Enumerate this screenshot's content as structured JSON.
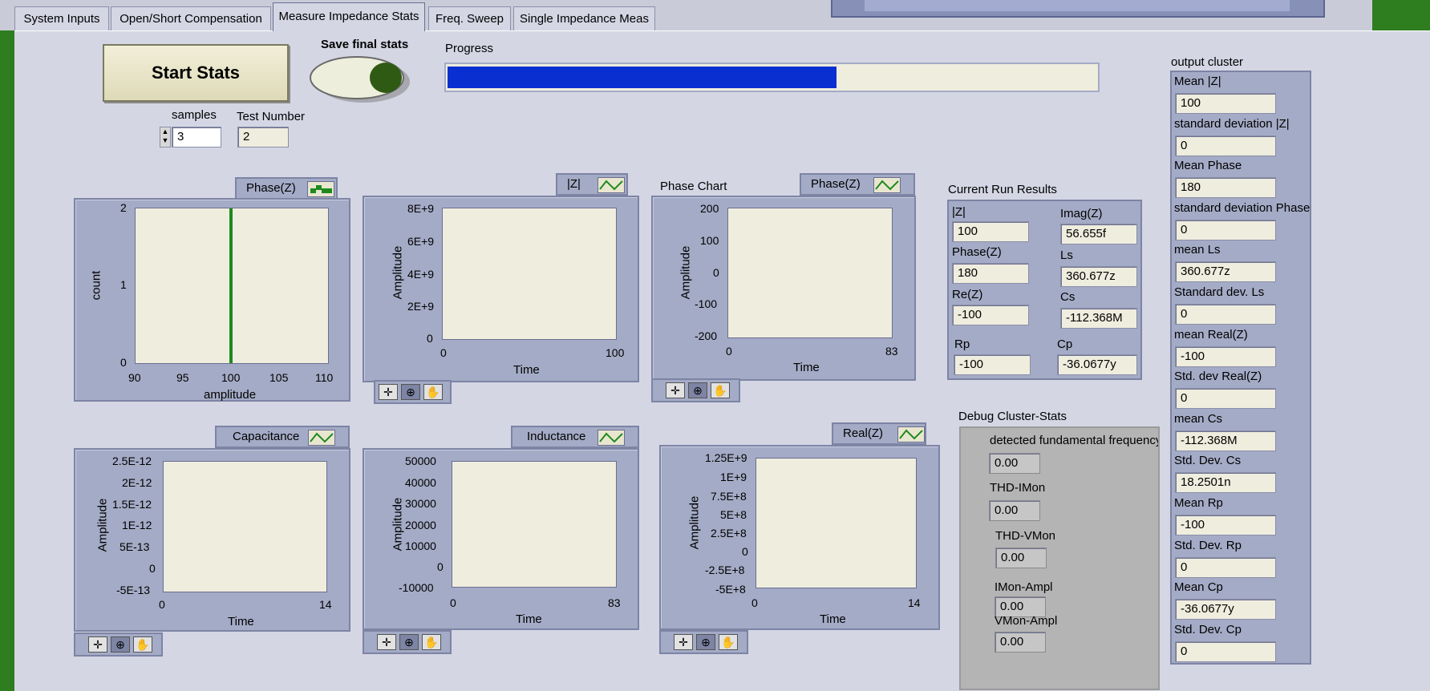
{
  "tabs": [
    "System Inputs",
    "Open/Short Compensation",
    "Measure Impedance Stats",
    "Freq. Sweep",
    "Single Impedance Meas"
  ],
  "controls": {
    "start_button": "Start Stats",
    "save_final_stats_label": "Save final stats",
    "progress_label": "Progress",
    "progress_fraction": 0.6,
    "samples_label": "samples",
    "samples_value": "3",
    "test_number_label": "Test Number",
    "test_number_value": "2"
  },
  "graphs": {
    "histogram": {
      "legend": "Phase(Z)",
      "y_ticks": [
        "2",
        "1",
        "0"
      ],
      "x_ticks": [
        "90",
        "95",
        "100",
        "105",
        "110"
      ],
      "ylabel": "count",
      "xlabel": "amplitude",
      "bar_x": 100
    },
    "z_chart": {
      "legend": "|Z|",
      "y_ticks": [
        "8E+9",
        "6E+9",
        "4E+9",
        "2E+9",
        "0"
      ],
      "x_ticks": [
        "0",
        "100"
      ],
      "ylabel": "Amplitude",
      "xlabel": "Time"
    },
    "phase_chart": {
      "title": "Phase Chart",
      "legend": "Phase(Z)",
      "y_ticks": [
        "200",
        "100",
        "0",
        "-100",
        "-200"
      ],
      "x_ticks": [
        "0",
        "83"
      ],
      "ylabel": "Amplitude",
      "xlabel": "Time"
    },
    "capacitance_chart": {
      "legend": "Capacitance",
      "y_ticks": [
        "2.5E-12",
        "2E-12",
        "1.5E-12",
        "1E-12",
        "5E-13",
        "0",
        "-5E-13"
      ],
      "x_ticks": [
        "0",
        "14"
      ],
      "ylabel": "Amplitude",
      "xlabel": "Time"
    },
    "inductance_chart": {
      "legend": "Inductance",
      "y_ticks": [
        "50000",
        "40000",
        "30000",
        "20000",
        "10000",
        "0",
        "-10000"
      ],
      "x_ticks": [
        "0",
        "83"
      ],
      "ylabel": "Amplitude",
      "xlabel": "Time"
    },
    "real_chart": {
      "legend": "Real(Z)",
      "y_ticks": [
        "1.25E+9",
        "1E+9",
        "7.5E+8",
        "5E+8",
        "2.5E+8",
        "0",
        "-2.5E+8",
        "-5E+8"
      ],
      "x_ticks": [
        "0",
        "14"
      ],
      "ylabel": "Amplitude",
      "xlabel": "Time"
    }
  },
  "current_run": {
    "title": "Current Run Results",
    "z_label": "|Z|",
    "z_value": "100",
    "imag_label": "Imag(Z)",
    "imag_value": "56.655f",
    "phase_label": "Phase(Z)",
    "phase_value": "180",
    "ls_label": "Ls",
    "ls_value": "360.677z",
    "re_label": "Re(Z)",
    "re_value": "-100",
    "cs_label": "Cs",
    "cs_value": "-112.368M",
    "rp_label": "Rp",
    "rp_value": "-100",
    "cp_label": "Cp",
    "cp_value": "-36.0677y"
  },
  "debug": {
    "title": "Debug Cluster-Stats",
    "fund_label": "detected fundamental frequency",
    "fund_value": "0.00",
    "thd_imon_label": "THD-IMon",
    "thd_imon_value": "0.00",
    "thd_vmon_label": "THD-VMon",
    "thd_vmon_value": "0.00",
    "imon_ampl_label": "IMon-Ampl",
    "imon_ampl_value": "0.00",
    "vmon_ampl_label": "VMon-Ampl",
    "vmon_ampl_value": "0.00"
  },
  "output_cluster": {
    "title": "output cluster",
    "items": [
      {
        "label": "Mean |Z|",
        "value": "100"
      },
      {
        "label": "standard deviation |Z|",
        "value": "0"
      },
      {
        "label": "Mean Phase",
        "value": "180"
      },
      {
        "label": "standard deviation Phase",
        "value": "0"
      },
      {
        "label": "mean Ls",
        "value": "360.677z"
      },
      {
        "label": "Standard dev. Ls",
        "value": "0"
      },
      {
        "label": "mean Real(Z)",
        "value": "-100"
      },
      {
        "label": "Std. dev Real(Z)",
        "value": "0"
      },
      {
        "label": "mean Cs",
        "value": "-112.368M"
      },
      {
        "label": "Std. Dev. Cs",
        "value": "18.2501n"
      },
      {
        "label": "Mean Rp",
        "value": "-100"
      },
      {
        "label": "Std. Dev. Rp",
        "value": "0"
      },
      {
        "label": "Mean Cp",
        "value": "-36.0677y"
      },
      {
        "label": "Std. Dev. Cp",
        "value": "0"
      }
    ]
  },
  "colors": {
    "progress_fill": "#0a2fd0",
    "histogram_bar": "#1e8a1e",
    "led_green": "#2f5a14"
  },
  "icons": {
    "legend_line": "line-plot-icon",
    "legend_bar": "bar-plot-icon",
    "toolbar": [
      "cursor-move-icon",
      "zoom-icon",
      "pan-hand-icon"
    ]
  }
}
